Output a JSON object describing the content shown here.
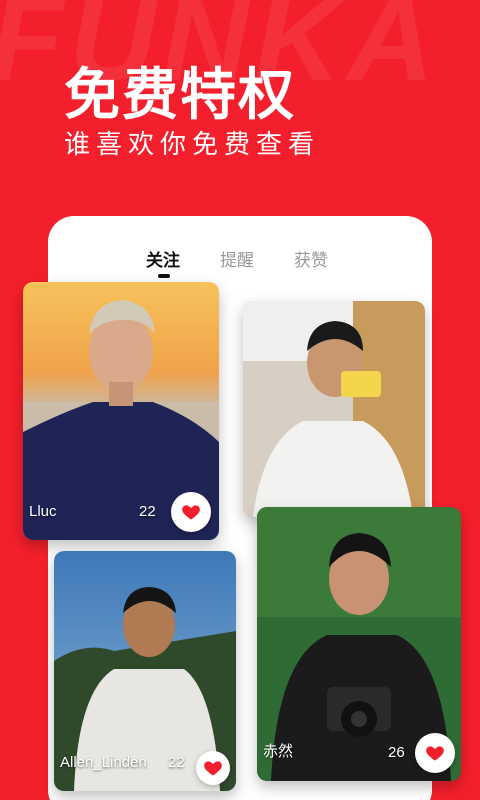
{
  "header": {
    "title": "免费特权",
    "subtitle": "谁喜欢你免费查看",
    "watermark": "FUNKA"
  },
  "tabs": [
    {
      "label": "关注",
      "active": true
    },
    {
      "label": "提醒",
      "active": false
    },
    {
      "label": "获赞",
      "active": false
    }
  ],
  "cards": [
    {
      "name": "Lluc",
      "age": "22"
    },
    {
      "name": "",
      "age": ""
    },
    {
      "name": "Allen_Linden",
      "age": "22"
    },
    {
      "name": "赤然",
      "age": "26"
    }
  ],
  "colors": {
    "brand": "#f41f2c",
    "heart": "#f41f2c"
  },
  "icons": {
    "like": "heart-icon"
  }
}
